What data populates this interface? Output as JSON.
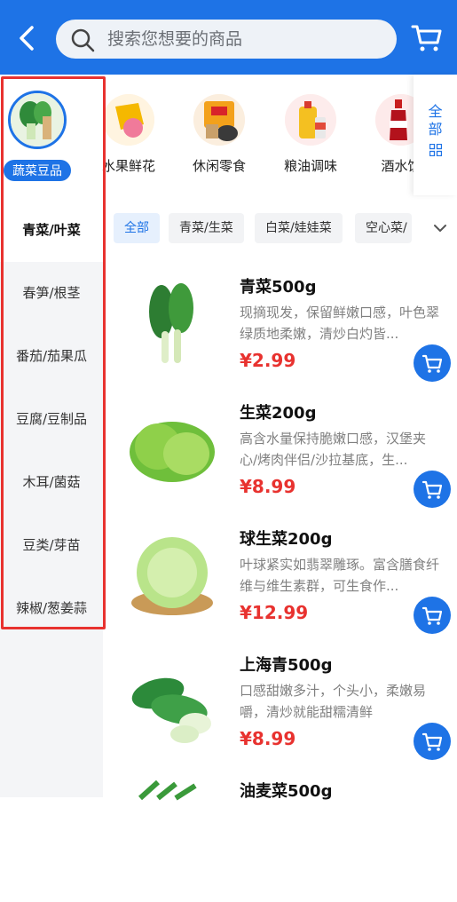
{
  "header": {
    "search_placeholder": "搜索您想要的商品"
  },
  "top_categories": [
    {
      "label": "蔬菜豆品",
      "active": true
    },
    {
      "label": "水果鲜花"
    },
    {
      "label": "休闲零食"
    },
    {
      "label": "粮油调味"
    },
    {
      "label": "酒水饮"
    }
  ],
  "all_button": {
    "label_line1": "全",
    "label_line2": "部"
  },
  "sidebar": {
    "items": [
      {
        "label": "青菜/叶菜"
      },
      {
        "label": "春笋/根茎"
      },
      {
        "label": "番茄/茄果瓜"
      },
      {
        "label": "豆腐/豆制品"
      },
      {
        "label": "木耳/菌菇"
      },
      {
        "label": "豆类/芽苗"
      },
      {
        "label": "辣椒/葱姜蒜"
      }
    ]
  },
  "chips": [
    {
      "label": "全部"
    },
    {
      "label": "青菜/生菜"
    },
    {
      "label": "白菜/娃娃菜"
    },
    {
      "label": "空心菜/"
    }
  ],
  "products": [
    {
      "name": "青菜500g",
      "desc": "现摘现发，保留鲜嫩口感，叶色翠绿质地柔嫩，清炒白灼皆...",
      "price": "¥2.99"
    },
    {
      "name": "生菜200g",
      "desc": "高含水量保持脆嫩口感，汉堡夹心/烤肉伴侣/沙拉基底，生...",
      "price": "¥8.99"
    },
    {
      "name": "球生菜200g",
      "desc": "叶球紧实如翡翠雕琢。富含膳食纤维与维生素群，可生食作...",
      "price": "¥12.99"
    },
    {
      "name": "上海青500g",
      "desc": "口感甜嫩多汁，个头小，柔嫩易嚼，清炒就能甜糯清鲜",
      "price": "¥8.99"
    },
    {
      "name": "油麦菜500g",
      "desc": "",
      "price": ""
    }
  ],
  "colors": {
    "accent": "#1e73e6",
    "price": "#e8322f",
    "highlight_box": "#e8322f"
  }
}
